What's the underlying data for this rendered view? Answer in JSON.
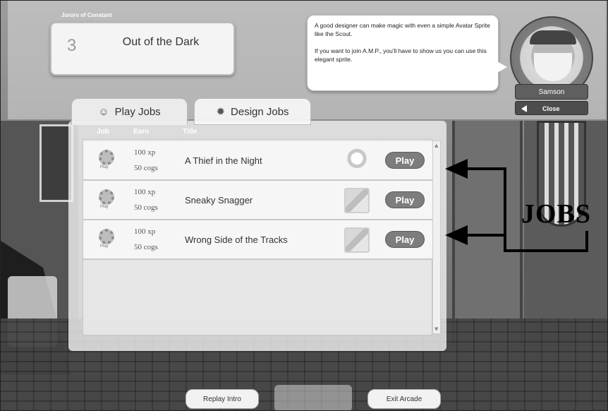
{
  "header": {
    "small_label": "Jurors of Constant",
    "level_number": "3",
    "level_title": "Out of the Dark"
  },
  "speech": {
    "line1": "A good designer can make magic with even a simple Avatar Sprite like the Scout.",
    "line2": "If you want to join A.M.P., you'll have to show us you can use this elegant sprite."
  },
  "character": {
    "name": "Samson",
    "close_label": "Close"
  },
  "tabs": [
    {
      "label": "Play Jobs",
      "icon": "people-icon",
      "active": true
    },
    {
      "label": "Design Jobs",
      "icon": "gear-icon",
      "active": false
    }
  ],
  "columns": [
    "Job",
    "Earn",
    "Title"
  ],
  "jobs": [
    {
      "icon_label": "Play",
      "xp": "100 xp",
      "cogs": "50 cogs",
      "title": "A Thief in the Night",
      "thumb": "character-icon",
      "action": "Play"
    },
    {
      "icon_label": "Play",
      "xp": "100 xp",
      "cogs": "50 cogs",
      "title": "Sneaky Snagger",
      "thumb": "map-icon",
      "action": "Play"
    },
    {
      "icon_label": "Play",
      "xp": "100 xp",
      "cogs": "50 cogs",
      "title": "Wrong Side of the Tracks",
      "thumb": "map-icon",
      "action": "Play"
    }
  ],
  "footer": {
    "replay_label": "Replay Intro",
    "exit_label": "Exit Arcade"
  },
  "annotation": {
    "label": "JOBS",
    "color": "#000000"
  }
}
